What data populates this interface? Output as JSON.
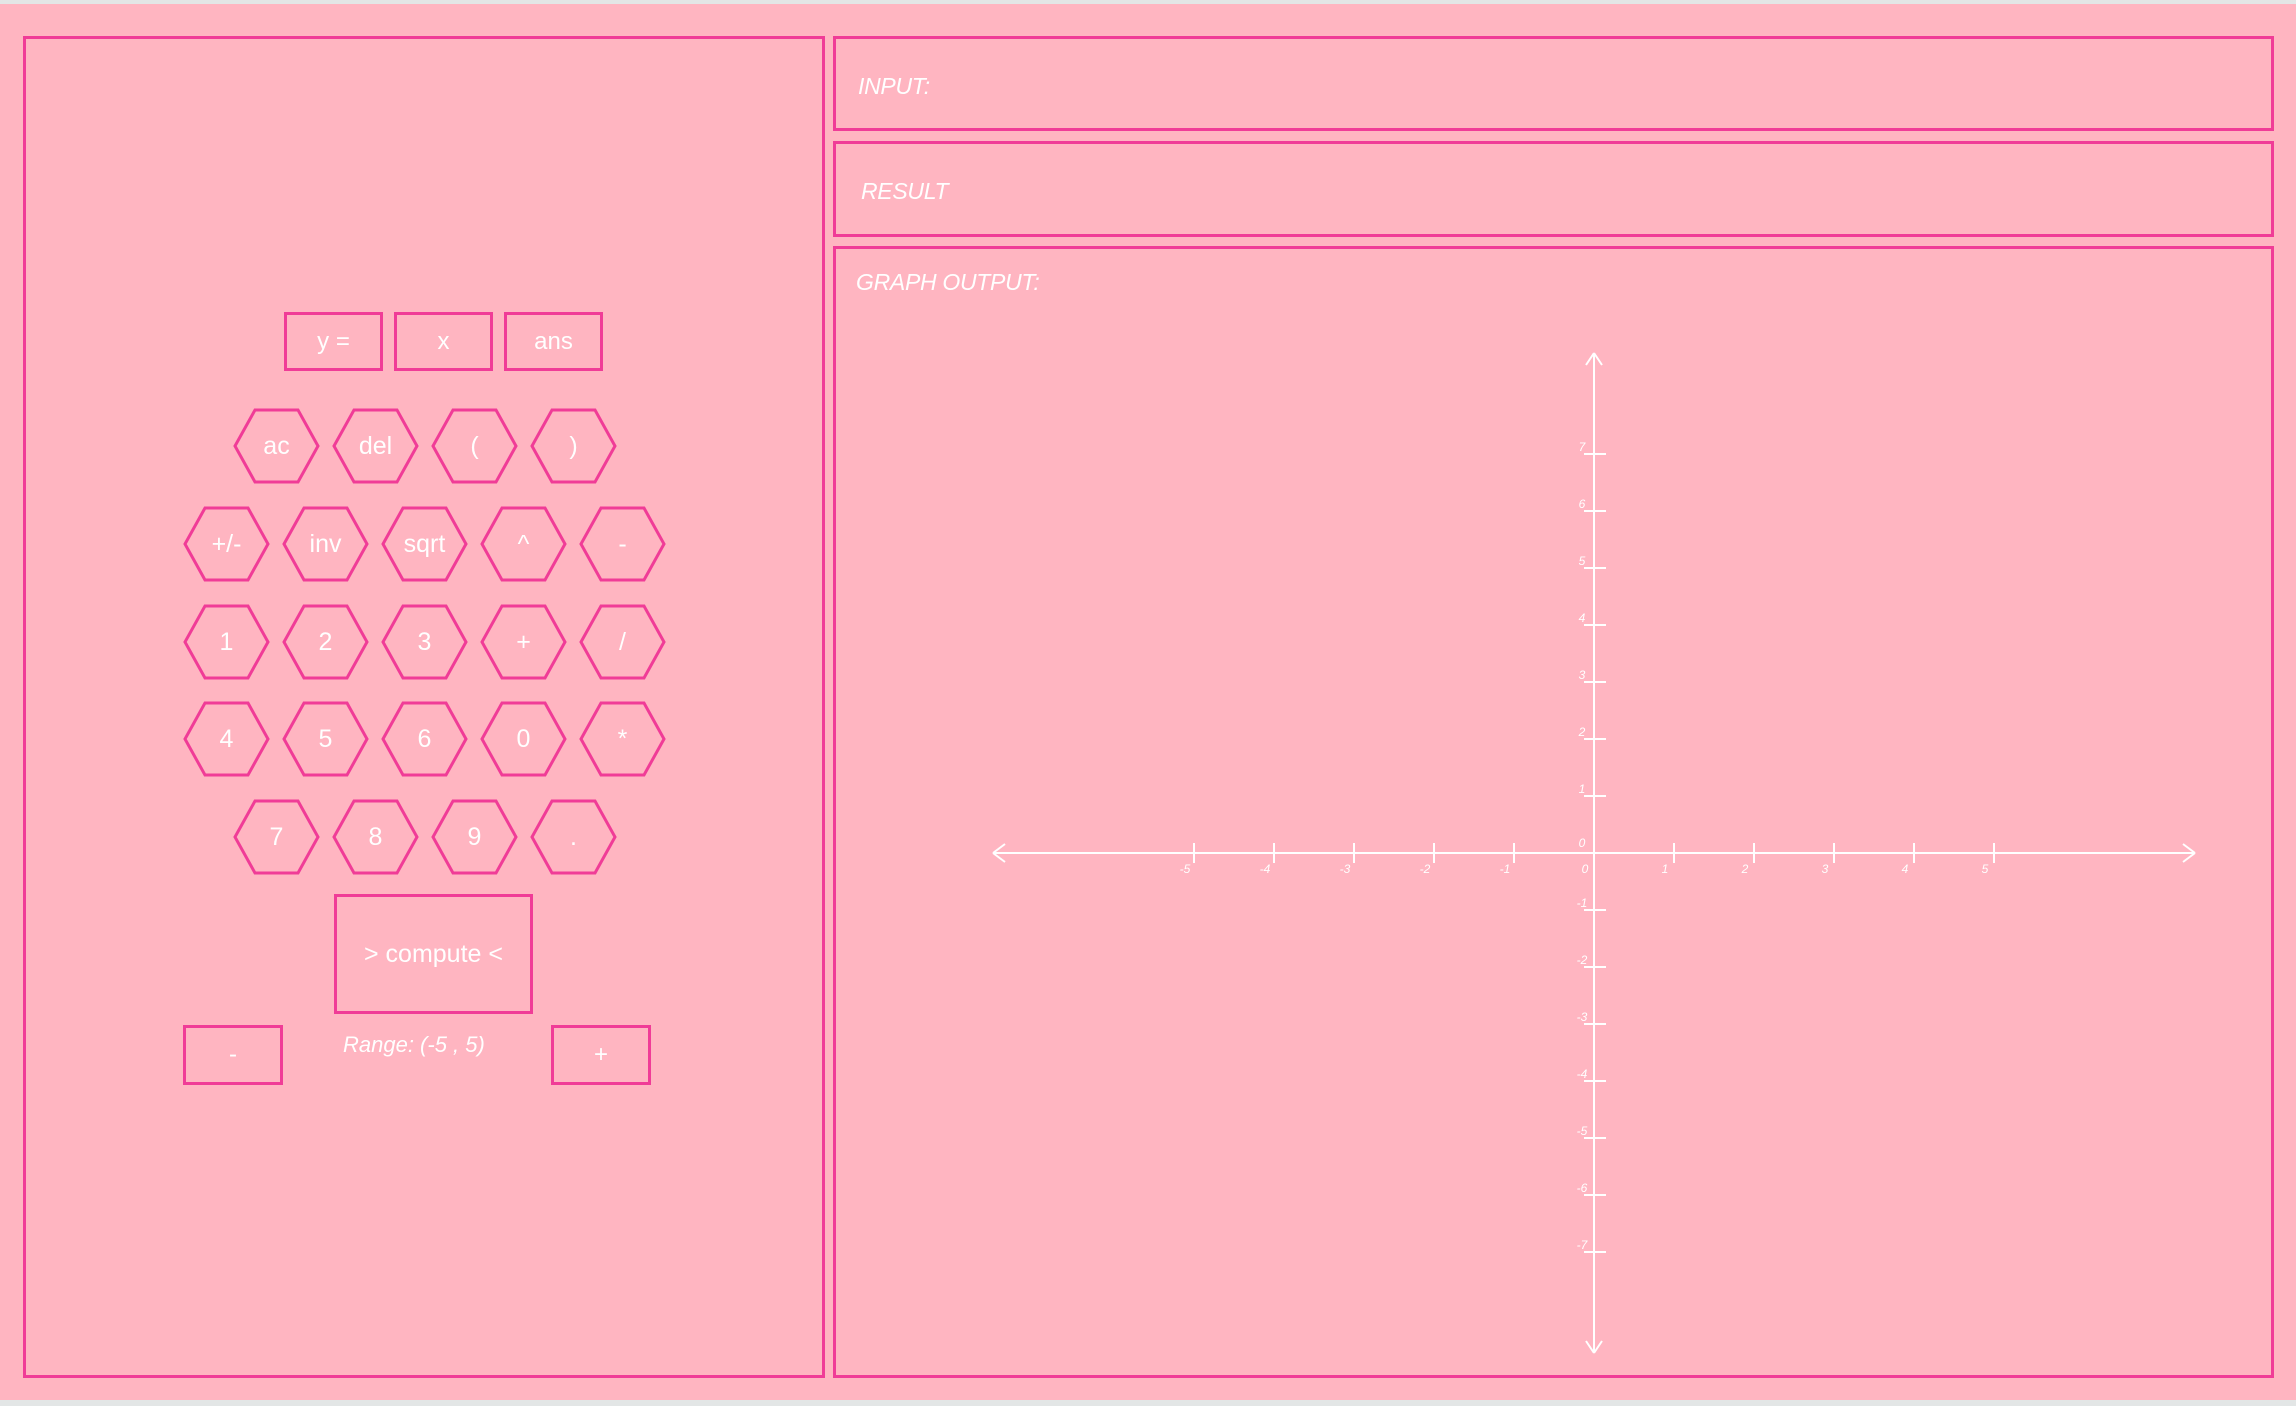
{
  "colors": {
    "background": "#ffb5c1",
    "accent": "#f03c97",
    "text": "#ffffff"
  },
  "input": {
    "label": "INPUT:"
  },
  "result": {
    "label": "RESULT"
  },
  "graph": {
    "label": "GRAPH OUTPUT:",
    "x_ticks": [
      "-5",
      "-4",
      "-3",
      "-2",
      "-1",
      "0",
      "1",
      "2",
      "3",
      "4",
      "5"
    ],
    "y_ticks": [
      "7",
      "6",
      "5",
      "4",
      "3",
      "2",
      "1",
      "0",
      "-1",
      "-2",
      "-3",
      "-4",
      "-5",
      "-6",
      "-7"
    ],
    "x_range": [
      -5,
      5
    ],
    "y_range": [
      -7,
      7
    ]
  },
  "keypad": {
    "top_row": [
      "y =",
      "x",
      "ans"
    ],
    "rows": [
      [
        "ac",
        "del",
        "(",
        ")"
      ],
      [
        "+/-",
        "inv",
        "sqrt",
        "^",
        "-"
      ],
      [
        "1",
        "2",
        "3",
        "+",
        "/"
      ],
      [
        "4",
        "5",
        "6",
        "0",
        "*"
      ],
      [
        "7",
        "8",
        "9",
        "."
      ]
    ],
    "compute_label": "> compute <",
    "range_minus_label": "-",
    "range_plus_label": "+",
    "range_text": "Range: (-5 , 5)"
  }
}
